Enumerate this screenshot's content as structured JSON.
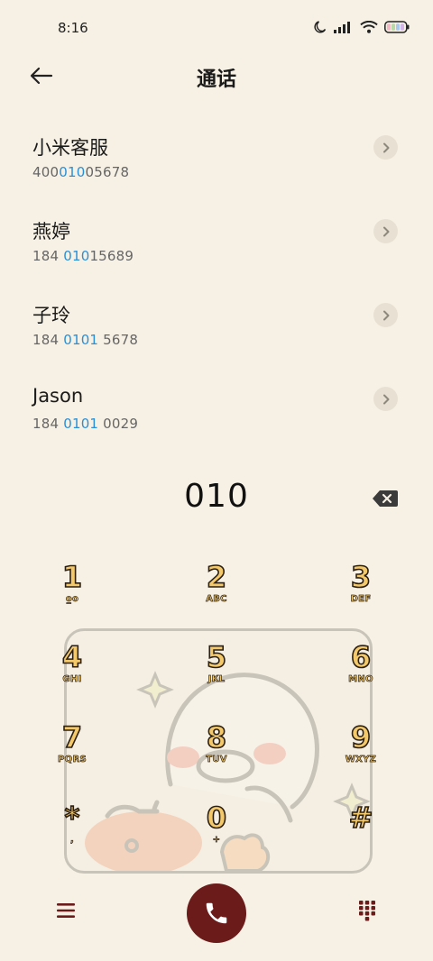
{
  "status": {
    "time": "8:16"
  },
  "header": {
    "title": "通话"
  },
  "contacts": [
    {
      "name": "小米客服",
      "number_pre": "400",
      "number_hl": "010",
      "number_post": "05678"
    },
    {
      "name": "燕婷",
      "number_pre": "184 ",
      "number_hl": "010",
      "number_post": "15689"
    },
    {
      "name": "子玲",
      "number_pre": "184 ",
      "number_hl": "0101",
      "number_post": " 5678"
    },
    {
      "name": "Jason",
      "number_pre": "184 ",
      "number_hl": "0101",
      "number_post": " 0029"
    }
  ],
  "dialer": {
    "input": "010",
    "keys": [
      {
        "digit": "1",
        "letters": "ᴏ̲ᴏ"
      },
      {
        "digit": "2",
        "letters": "ABC"
      },
      {
        "digit": "3",
        "letters": "DEF"
      },
      {
        "digit": "4",
        "letters": "GHI"
      },
      {
        "digit": "5",
        "letters": "JKL"
      },
      {
        "digit": "6",
        "letters": "MNO"
      },
      {
        "digit": "7",
        "letters": "PQRS"
      },
      {
        "digit": "8",
        "letters": "TUV"
      },
      {
        "digit": "9",
        "letters": "WXYZ"
      },
      {
        "digit": "*",
        "letters": ","
      },
      {
        "digit": "0",
        "letters": "+"
      },
      {
        "digit": "#",
        "letters": ""
      }
    ]
  },
  "colors": {
    "background": "#f7f1e5",
    "highlight": "#2a8fd6",
    "call_button": "#6b1c1a",
    "key_fill": "#f3c96b"
  }
}
